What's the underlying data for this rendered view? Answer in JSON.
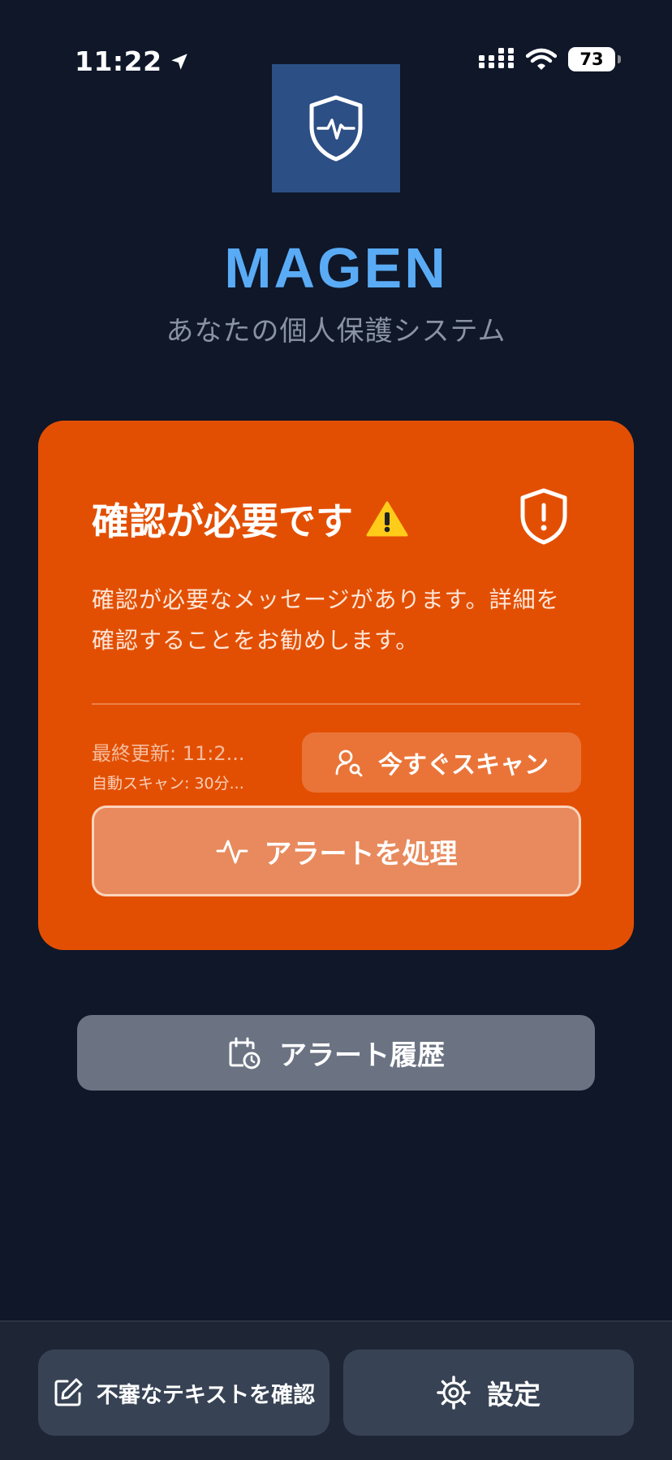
{
  "status_bar": {
    "time": "11:22",
    "battery": "73"
  },
  "header": {
    "title": "MAGEN",
    "subtitle": "あなたの個人保護システム"
  },
  "alert_card": {
    "title": "確認が必要です",
    "title_emoji": "⚠️",
    "message": "確認が必要なメッセージがあります。詳細を確認することをお勧めします。",
    "last_updated": "最終更新: 11:2...",
    "auto_scan": "自動スキャン: 30分...",
    "scan_now_label": "今すぐスキャン",
    "process_alert_label": "アラートを処理",
    "background_color": "#e34f02"
  },
  "history": {
    "label": "アラート履歴"
  },
  "bottom_bar": {
    "check_text_label": "不審なテキストを確認",
    "settings_label": "設定"
  },
  "icons": {
    "logo": "shield-pulse-icon",
    "card": "shield-alert-icon",
    "scan": "user-search-icon",
    "process": "activity-icon",
    "history": "calendar-clock-icon",
    "check_text": "edit-icon",
    "settings": "gear-icon"
  },
  "colors": {
    "background": "#0f1729",
    "accent": "#5aabf5",
    "logo_bg": "#2c4f85"
  }
}
